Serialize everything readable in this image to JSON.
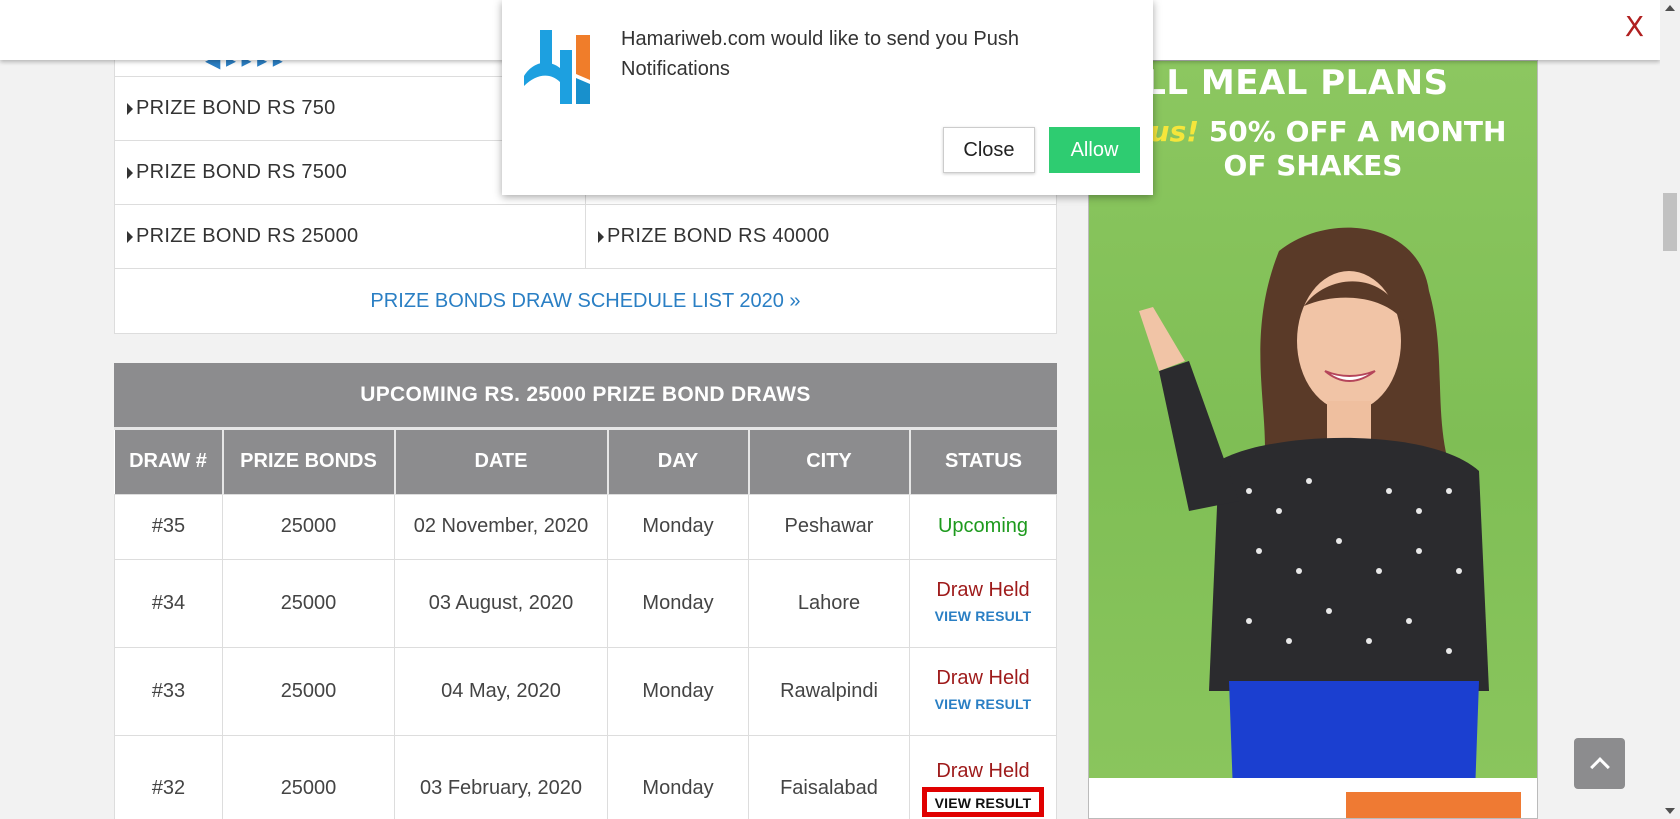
{
  "topbar": {
    "close_label": "X"
  },
  "push": {
    "message": "Hamariweb.com would like to send you Push Notifications",
    "close_label": "Close",
    "allow_label": "Allow"
  },
  "bond_links": {
    "rows": [
      [
        "PRIZE BOND RS 750",
        ""
      ],
      [
        "PRIZE BOND RS 7500",
        ""
      ],
      [
        "PRIZE BOND RS 25000",
        "PRIZE BOND RS 40000"
      ]
    ],
    "schedule_label": "PRIZE BONDS DRAW SCHEDULE LIST 2020 »"
  },
  "draws": {
    "caption": "UPCOMING RS. 25000 PRIZE BOND DRAWS",
    "headers": [
      "DRAW #",
      "PRIZE BONDS",
      "DATE",
      "DAY",
      "CITY",
      "STATUS"
    ],
    "rows": [
      {
        "draw": "#35",
        "bonds": "25000",
        "date": "02 November, 2020",
        "day": "Monday",
        "city": "Peshawar",
        "status": "Upcoming",
        "link": ""
      },
      {
        "draw": "#34",
        "bonds": "25000",
        "date": "03 August, 2020",
        "day": "Monday",
        "city": "Lahore",
        "status": "Draw Held",
        "link": "VIEW RESULT"
      },
      {
        "draw": "#33",
        "bonds": "25000",
        "date": "04 May, 2020",
        "day": "Monday",
        "city": "Rawalpindi",
        "status": "Draw Held",
        "link": "VIEW RESULT"
      },
      {
        "draw": "#32",
        "bonds": "25000",
        "date": "03 February, 2020",
        "day": "Monday",
        "city": "Faisalabad",
        "status": "Draw Held",
        "link": "VIEW RESULT"
      }
    ]
  },
  "ad": {
    "headline": "ALL MEAL PLANS",
    "plus_word": "Plus!",
    "sub_line1": "50% OFF A MONTH",
    "sub_line2": "OF SHAKES"
  },
  "colors": {
    "accent_link": "#2a7fc4",
    "status_upcoming": "#1d9a1d",
    "status_held": "#9e1a1a",
    "allow_green": "#2ecc71",
    "header_gray": "#8c8c8e"
  }
}
